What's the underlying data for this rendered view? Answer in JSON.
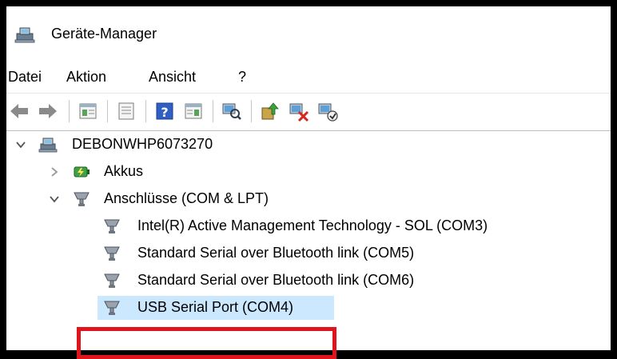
{
  "window": {
    "title": "Geräte-Manager",
    "icon": "device-manager-icon"
  },
  "menu": {
    "items": [
      "Datei",
      "Aktion",
      "Ansicht",
      "?"
    ]
  },
  "toolbar": {
    "buttons": [
      {
        "name": "back",
        "icon": "arrow-left-icon"
      },
      {
        "name": "forward",
        "icon": "arrow-right-icon"
      },
      {
        "name": "show-hide-console-tree",
        "icon": "console-tree-icon"
      },
      {
        "name": "properties",
        "icon": "properties-icon"
      },
      {
        "name": "help",
        "icon": "help-icon"
      },
      {
        "name": "action-pane",
        "icon": "action-pane-icon"
      },
      {
        "name": "scan-hardware",
        "icon": "scan-hardware-icon"
      },
      {
        "name": "update-driver",
        "icon": "update-driver-icon"
      },
      {
        "name": "uninstall-device",
        "icon": "uninstall-device-icon"
      },
      {
        "name": "enable-device",
        "icon": "enable-device-icon"
      }
    ]
  },
  "tree": {
    "root": {
      "label": "DEBONWHP6073270",
      "expanded": true
    },
    "categories": [
      {
        "label": "Akkus",
        "expanded": false,
        "icon": "battery-icon"
      },
      {
        "label": "Anschlüsse (COM & LPT)",
        "expanded": true,
        "icon": "port-icon",
        "children": [
          {
            "label": "Intel(R) Active Management Technology - SOL (COM3)",
            "icon": "port-icon"
          },
          {
            "label": "Standard Serial over Bluetooth link (COM5)",
            "icon": "port-icon"
          },
          {
            "label": "Standard Serial over Bluetooth link (COM6)",
            "icon": "port-icon"
          },
          {
            "label": "USB Serial Port (COM4)",
            "icon": "port-icon",
            "selected": true
          }
        ]
      }
    ]
  },
  "colors": {
    "selection": "#cce8ff",
    "highlight_border": "#e0151b"
  }
}
